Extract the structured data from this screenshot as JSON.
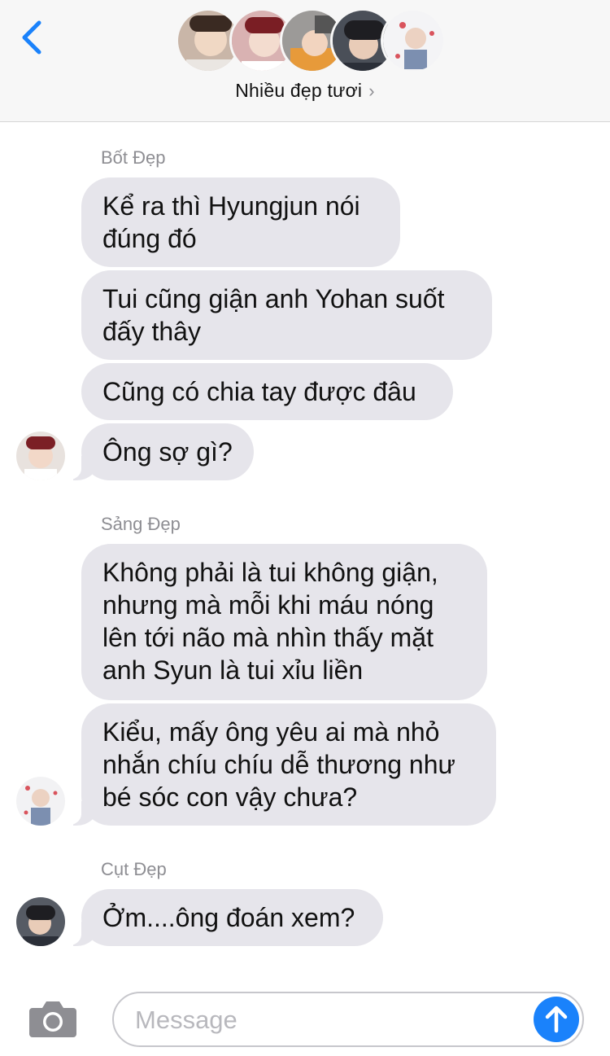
{
  "header": {
    "group_name": "Nhiều đẹp tươi",
    "back_icon": "chevron-left-icon",
    "chevron": "›",
    "accent": "#1a82fb"
  },
  "conversation": [
    {
      "sender": "Bốt Đẹp",
      "messages": [
        "Kể ra thì Hyungjun nói đúng đó",
        "Tui cũng giận anh Yohan suốt đấy thây",
        "Cũng có chia tay được đâu",
        "Ông sợ gì?"
      ]
    },
    {
      "sender": "Sảng Đẹp",
      "messages": [
        "Không phải là tui không giận, nhưng mà mỗi khi máu nóng lên tới não mà nhìn thấy mặt anh Syun là tui xỉu liền",
        "Kiểu, mấy ông yêu ai mà nhỏ nhắn chíu chíu dễ thương như bé sóc con vậy chưa?"
      ]
    },
    {
      "sender": "Cụt Đẹp",
      "messages": [
        "Ởm....ông đoán xem?"
      ]
    }
  ],
  "composer": {
    "placeholder": "Message",
    "camera_icon": "camera-icon",
    "send_icon": "arrow-up-icon"
  },
  "colors": {
    "bubble": "#e6e5eb",
    "header_bg": "#f7f7f7",
    "send": "#1a82fb"
  }
}
